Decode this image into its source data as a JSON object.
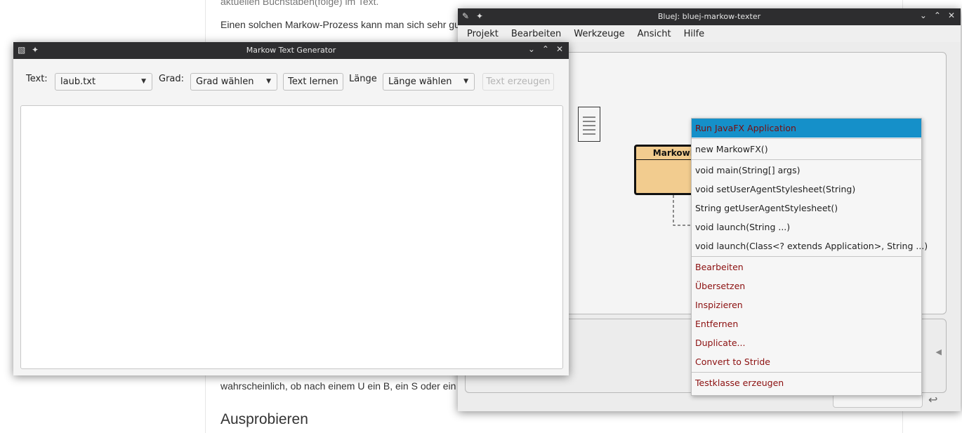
{
  "background_page": {
    "line_top": "aktuellen Buchstaben(folge) im Text.",
    "line1": "Einen solchen Markow-Prozess kann man sich sehr gu",
    "line2": "wahrscheinlich, ob nach einem U ein B, ein S oder ein",
    "heading": "Ausprobieren"
  },
  "bluej": {
    "title": "BlueJ: bluej-markow-texter",
    "menu": [
      "Projekt",
      "Bearbeiten",
      "Werkzeuge",
      "Ansicht",
      "Hilfe"
    ],
    "class_name": "MarkowFX",
    "context_menu": {
      "run": "Run JavaFX Application",
      "constructor": "new MarkowFX()",
      "methods": [
        "void main(String[] args)",
        "void setUserAgentStylesheet(String)",
        "String getUserAgentStylesheet()",
        "void launch(String ...)",
        "void launch(Class<? extends Application>, String ...)"
      ],
      "actions": [
        "Bearbeiten",
        "Übersetzen",
        "Inspizieren",
        "Entfernen",
        "Duplicate...",
        "Convert to Stride"
      ],
      "test": "Testklasse erzeugen"
    }
  },
  "markow": {
    "title": "Markow Text Generator",
    "text_label": "Text:",
    "text_value": "laub.txt",
    "grad_label": "Grad:",
    "grad_value": "Grad wählen",
    "learn_button": "Text lernen",
    "laenge_label": "Länge",
    "laenge_value": "Länge wählen",
    "generate_button": "Text erzeugen"
  },
  "colors": {
    "titlebar": "#2d2d2f",
    "selection": "#1590c9",
    "menu_action_text": "#8b0f0f",
    "class_fill": "#f2cc8f"
  }
}
